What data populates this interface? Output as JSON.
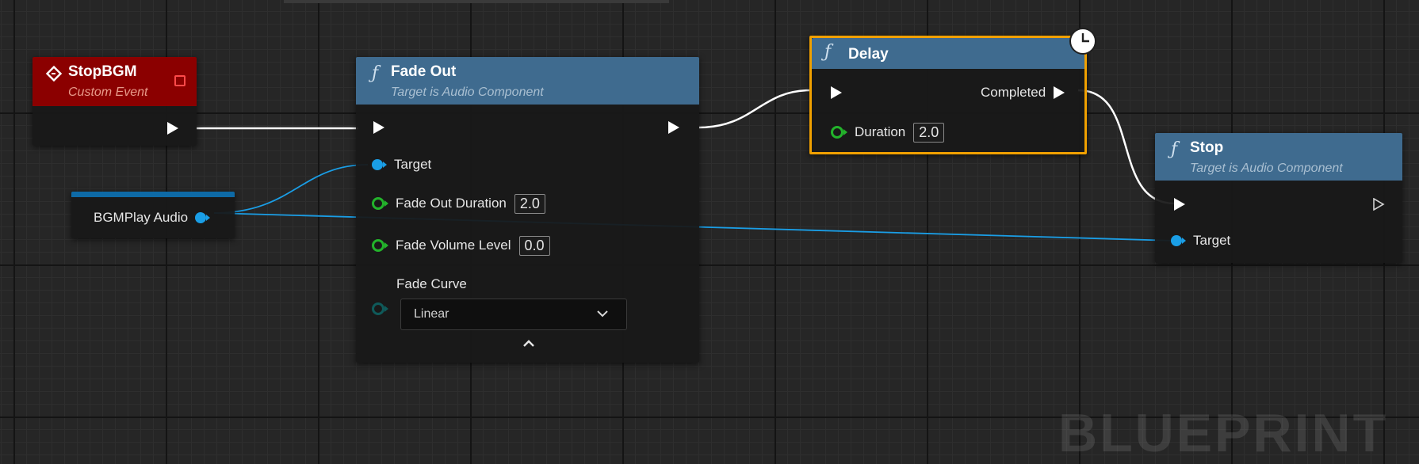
{
  "event_node": {
    "title": "StopBGM",
    "subtitle": "Custom Event",
    "header_color": "#8b0000"
  },
  "variable_node": {
    "label": "BGMPlay Audio"
  },
  "fade_out_node": {
    "title": "Fade Out",
    "subtitle": "Target is Audio Component",
    "pins": {
      "target": "Target",
      "fade_out_duration": "Fade Out Duration",
      "fade_out_duration_value": "2.0",
      "fade_volume_level": "Fade Volume Level",
      "fade_volume_level_value": "0.0",
      "fade_curve": "Fade Curve",
      "fade_curve_value": "Linear"
    }
  },
  "delay_node": {
    "title": "Delay",
    "completed_label": "Completed",
    "duration_label": "Duration",
    "duration_value": "2.0",
    "border_color": "#f0a000"
  },
  "stop_node": {
    "title": "Stop",
    "subtitle": "Target is Audio Component",
    "target_label": "Target"
  },
  "watermark": "BLUEPRINT",
  "colors": {
    "exec_wire": "#ffffff",
    "object_pin": "#1a9ee6",
    "float_pin": "#23b32b",
    "function_header": "#3f6b8f",
    "grid_bg": "#262626"
  }
}
